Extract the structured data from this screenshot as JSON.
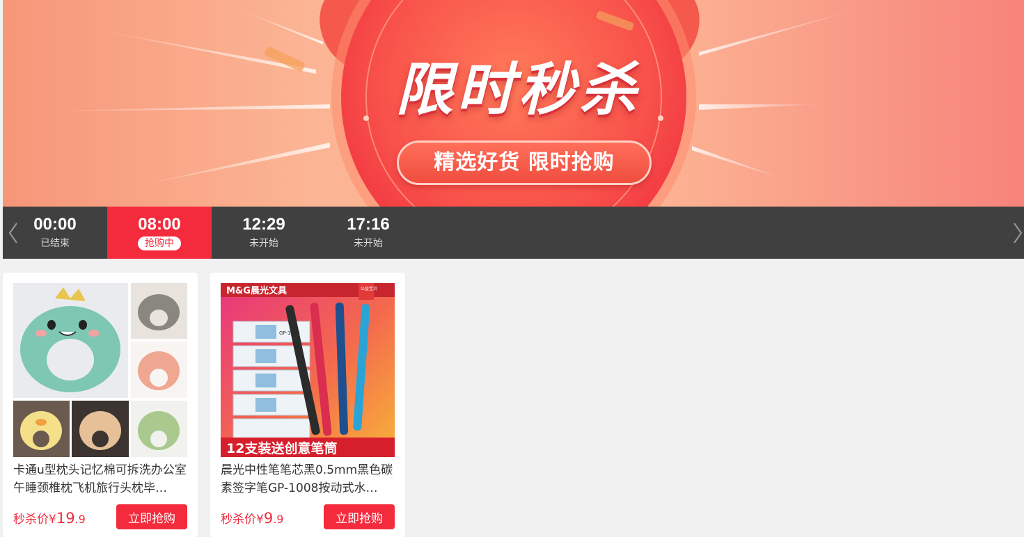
{
  "banner": {
    "title": "限时秒杀",
    "subtitle": "精选好货 限时抢购"
  },
  "timebar": {
    "slots": [
      {
        "time": "00:00",
        "status": "已结束"
      },
      {
        "time": "08:00",
        "status": "抢购中"
      },
      {
        "time": "12:29",
        "status": "未开始"
      },
      {
        "time": "17:16",
        "status": "未开始"
      }
    ],
    "active_index": 1,
    "prev_icon": "chevron-left-icon",
    "next_icon": "chevron-right-icon"
  },
  "products": [
    {
      "title": "卡通u型枕头记忆棉可拆洗办公室午睡颈椎枕飞机旅行头枕毕…",
      "price_label": "秒杀价¥",
      "price_int": "19",
      "price_dec": ".9",
      "button": "立即抢购"
    },
    {
      "title": "晨光中性笔笔芯黑0.5mm黑色碳素签字笔GP-1008按动式水…",
      "price_label": "秒杀价¥",
      "price_int": "9",
      "price_dec": ".9",
      "button": "立即抢购",
      "image_texts": {
        "brand": "M&G晨光文具",
        "badge": "公益宝贝",
        "promo": "12支装送创意笔筒",
        "box_model": "GP-1008"
      }
    }
  ],
  "colors": {
    "accent": "#f42b3d",
    "timebar_bg": "#404040",
    "page_bg": "#f1f1f1"
  }
}
